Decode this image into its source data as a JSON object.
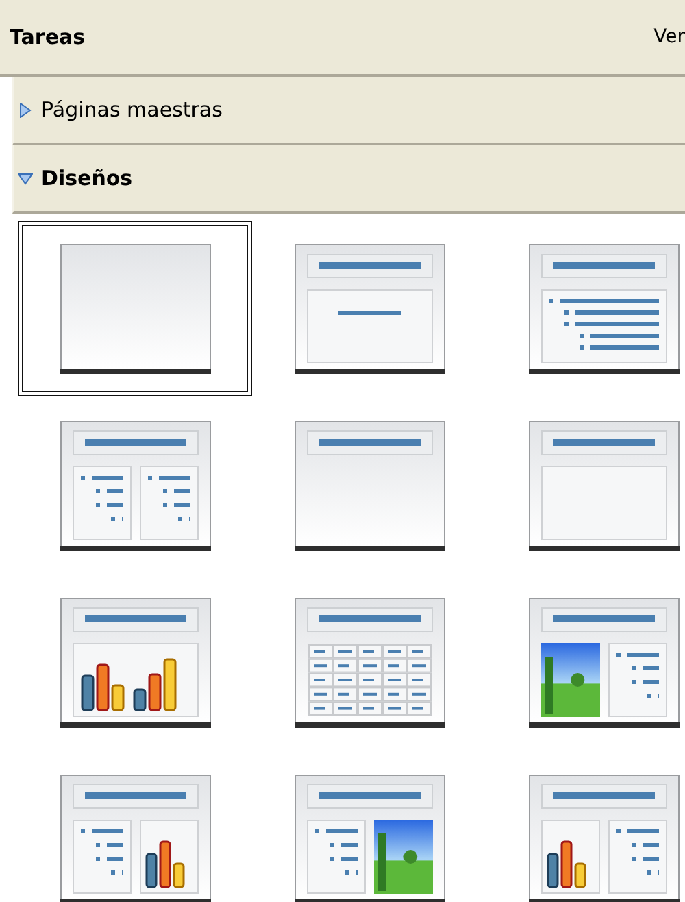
{
  "panel": {
    "title": "Tareas",
    "menu": "Ver"
  },
  "sections": [
    {
      "label": "Páginas maestras",
      "expanded": false
    },
    {
      "label": "Diseños",
      "expanded": true,
      "layouts": [
        {
          "kind": "blank",
          "selected": true
        },
        {
          "kind": "title-centered-text",
          "selected": false
        },
        {
          "kind": "title-outline",
          "selected": false
        },
        {
          "kind": "title-two-outlines",
          "selected": false
        },
        {
          "kind": "title-only",
          "selected": false
        },
        {
          "kind": "title-content",
          "selected": false
        },
        {
          "kind": "title-chart",
          "selected": false
        },
        {
          "kind": "title-table",
          "selected": false
        },
        {
          "kind": "title-image-outline",
          "selected": false
        },
        {
          "kind": "title-outline-chart",
          "selected": false
        },
        {
          "kind": "title-outline-image",
          "selected": false
        },
        {
          "kind": "title-chart-outline",
          "selected": false
        }
      ]
    }
  ]
}
